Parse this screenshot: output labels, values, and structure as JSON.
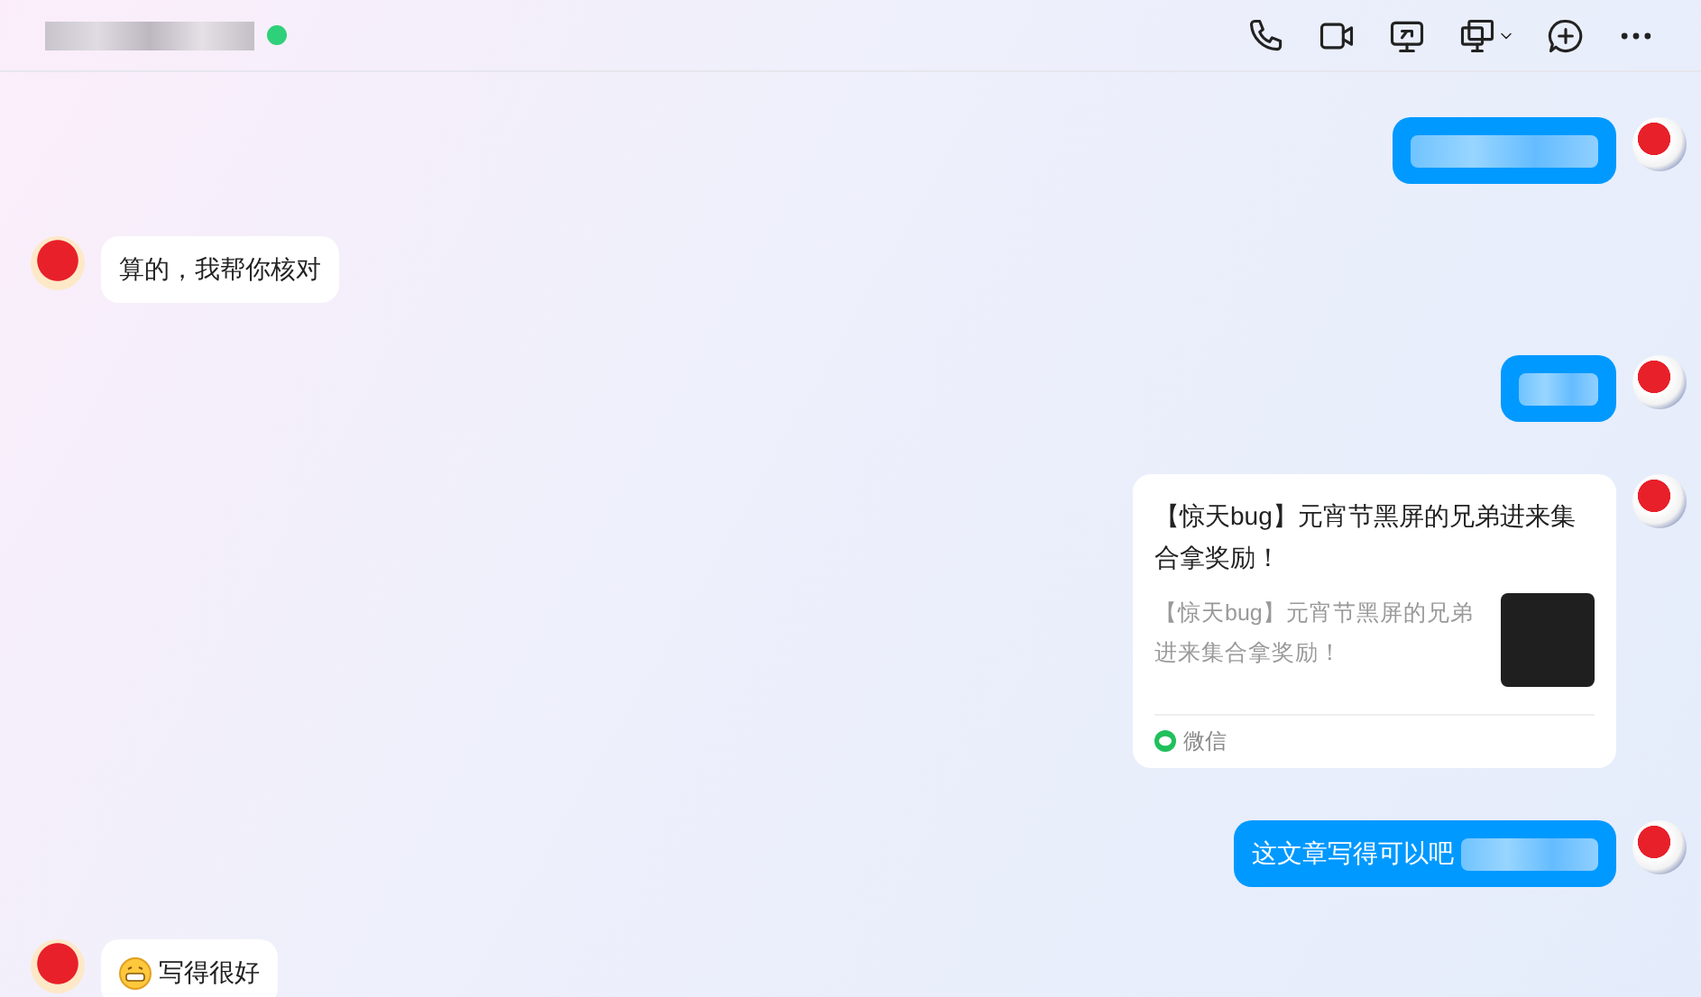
{
  "header": {
    "title_redacted": true,
    "online": true
  },
  "messages": [
    {
      "kind": "text",
      "outgoing": true,
      "redacted": true
    },
    {
      "kind": "text",
      "outgoing": false,
      "text": "算的，我帮你核对",
      "redacted": false
    },
    {
      "kind": "text",
      "outgoing": true,
      "redacted": true
    },
    {
      "kind": "link-card",
      "outgoing": true,
      "title": "【惊天bug】元宵节黑屏的兄弟进来集合拿奖励！",
      "summary": "【惊天bug】元宵节黑屏的兄弟进来集合拿奖励！",
      "source": "微信"
    },
    {
      "kind": "text",
      "outgoing": true,
      "text": "这文章写得可以吧",
      "redacted": true
    },
    {
      "kind": "emoji-text",
      "outgoing": false,
      "text": "写得很好",
      "redacted": false
    }
  ]
}
